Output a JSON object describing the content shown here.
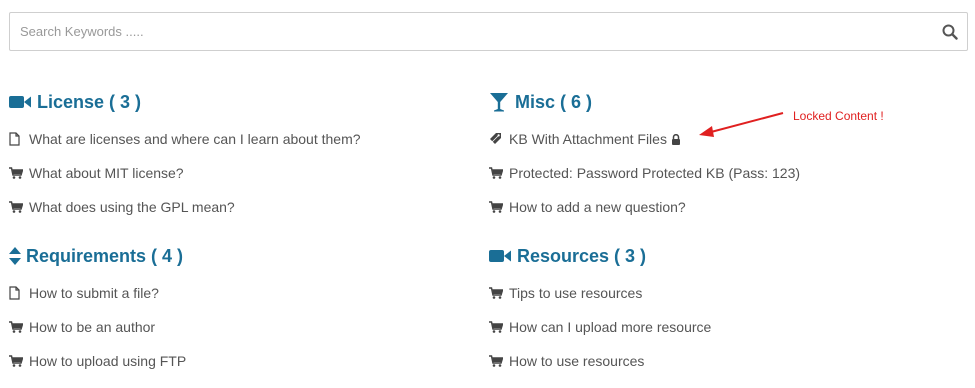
{
  "search": {
    "placeholder": "Search Keywords .....",
    "icon": "search-icon"
  },
  "categories": [
    {
      "title": "License ( 3 )",
      "icon": "video-camera-icon",
      "items": [
        {
          "label": "What are licenses and where can I learn about them?",
          "icon": "document-icon"
        },
        {
          "label": "What about MIT license?",
          "icon": "cart-icon"
        },
        {
          "label": "What does using the GPL mean?",
          "icon": "cart-icon"
        }
      ]
    },
    {
      "title": "Misc ( 6 )",
      "icon": "cocktail-glass-icon",
      "items": [
        {
          "label": "KB With Attachment Files",
          "icon": "tags-icon",
          "locked": true
        },
        {
          "label": "Protected: Password Protected KB (Pass: 123)",
          "icon": "cart-icon"
        },
        {
          "label": "How to add a new question?",
          "icon": "cart-icon"
        }
      ]
    },
    {
      "title": "Requirements ( 4 )",
      "icon": "sort-icon",
      "items": [
        {
          "label": "How to submit a file?",
          "icon": "document-icon"
        },
        {
          "label": "How to be an author",
          "icon": "cart-icon"
        },
        {
          "label": "How to upload using FTP",
          "icon": "cart-icon"
        }
      ]
    },
    {
      "title": "Resources ( 3 )",
      "icon": "video-camera-icon",
      "items": [
        {
          "label": "Tips to use resources",
          "icon": "cart-icon"
        },
        {
          "label": "How can I upload more resource",
          "icon": "cart-icon"
        },
        {
          "label": "How to use resources",
          "icon": "cart-icon"
        }
      ]
    }
  ],
  "annotation": {
    "text": "Locked Content !",
    "color": "#e02020"
  },
  "colors": {
    "heading": "#1a6e96",
    "text": "#555555"
  }
}
